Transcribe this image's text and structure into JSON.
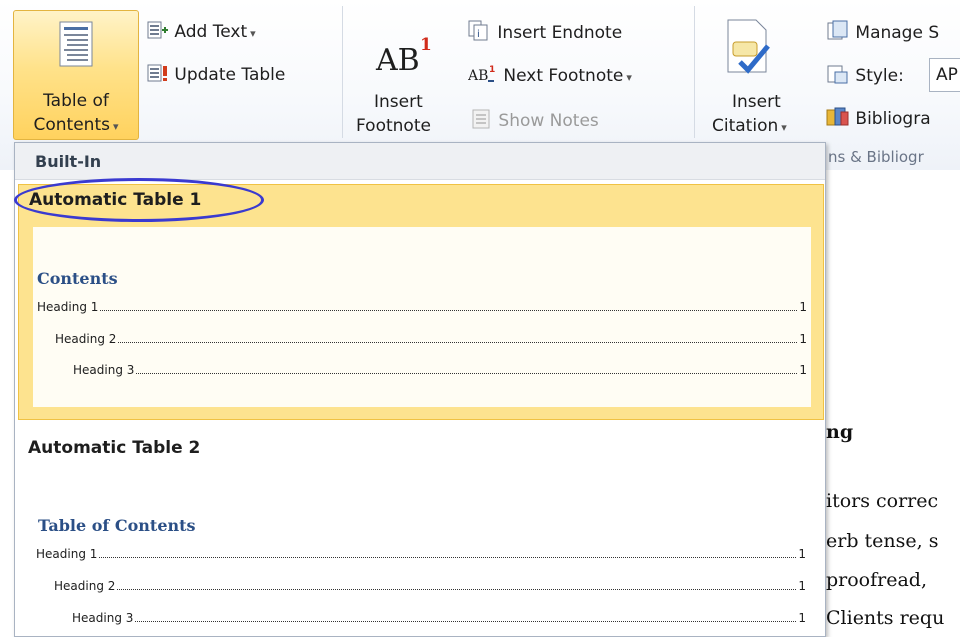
{
  "ribbon": {
    "toc_button": {
      "line1": "Table of",
      "line2": "Contents"
    },
    "add_text": "Add Text",
    "update_table": "Update Table",
    "insert_footnote": {
      "line1": "Insert",
      "line2": "Footnote"
    },
    "insert_endnote": "Insert Endnote",
    "next_footnote": "Next Footnote",
    "show_notes": "Show Notes",
    "insert_citation": {
      "line1": "Insert",
      "line2": "Citation"
    },
    "manage_sources": "Manage S",
    "style_label": "Style:",
    "style_value": "AP",
    "bibliography": "Bibliogra",
    "group_label": "ns & Bibliogr"
  },
  "gallery": {
    "header": "Built-In",
    "items": [
      {
        "title": "Automatic Table 1",
        "heading": "Contents",
        "entries": [
          {
            "text": "Heading 1",
            "page": "1"
          },
          {
            "text": "Heading 2",
            "page": "1"
          },
          {
            "text": "Heading 3",
            "page": "1"
          }
        ]
      },
      {
        "title": "Automatic Table 2",
        "heading": "Table of Contents",
        "entries": [
          {
            "text": "Heading 1",
            "page": "1"
          },
          {
            "text": "Heading 2",
            "page": "1"
          },
          {
            "text": "Heading 3",
            "page": "1"
          }
        ]
      }
    ]
  },
  "document": {
    "fragments": [
      "ng",
      "itors correc",
      "erb tense, s",
      "proofread,",
      "Clients requ"
    ]
  },
  "colors": {
    "highlight": "#fde38f",
    "annotation_circle": "#3a3ad0",
    "toc_heading": "#2b4f86"
  }
}
